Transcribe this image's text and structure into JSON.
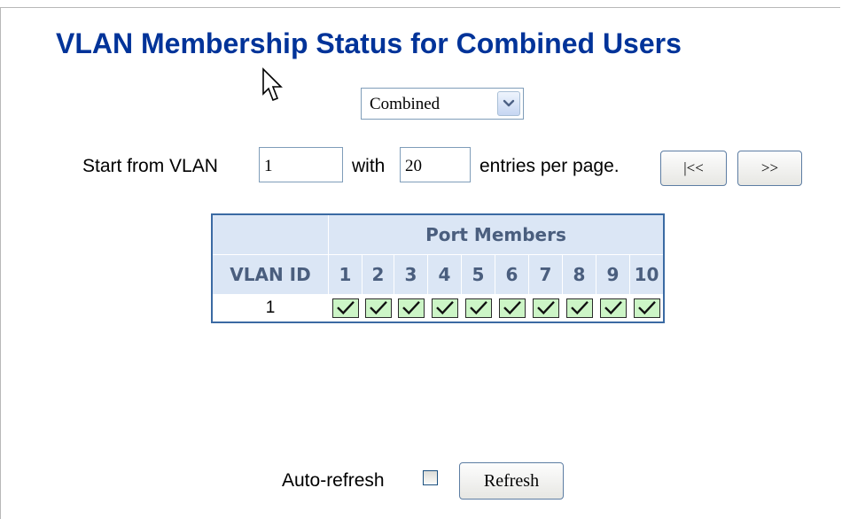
{
  "page": {
    "title": "VLAN Membership Status for Combined Users"
  },
  "user_select": {
    "value": "Combined"
  },
  "paging": {
    "start_label": "Start from VLAN",
    "start_value": "1",
    "with_label": "with",
    "entries_value": "20",
    "entries_label": "entries per page.",
    "first_button": "|<<",
    "next_button": ">>"
  },
  "table": {
    "group_header": "Port Members",
    "vlan_header": "VLAN ID",
    "ports": [
      "1",
      "2",
      "3",
      "4",
      "5",
      "6",
      "7",
      "8",
      "9",
      "10"
    ],
    "rows": [
      {
        "vlan_id": "1",
        "members": [
          true,
          true,
          true,
          true,
          true,
          true,
          true,
          true,
          true,
          true
        ]
      }
    ]
  },
  "footer": {
    "autorefresh_label": "Auto-refresh",
    "autorefresh_checked": false,
    "refresh_button": "Refresh"
  },
  "icons": {
    "cursor": "mouse-pointer-icon",
    "dropdown": "chevron-down-icon",
    "member": "checkmark-icon"
  },
  "colors": {
    "title": "#003399",
    "table_border": "#3b6aa3",
    "header_bg": "#dbe6f5",
    "header_text": "#4a5e7e",
    "member_bg": "#ccf5c6"
  }
}
